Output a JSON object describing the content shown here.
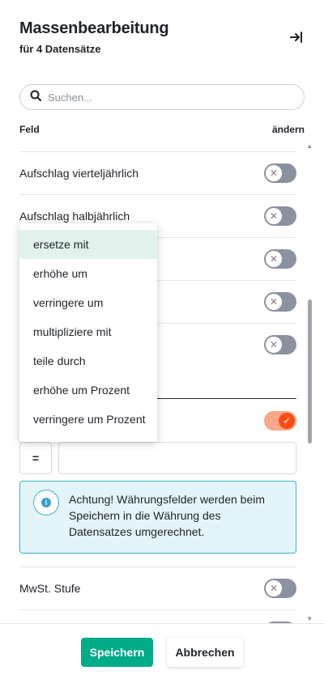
{
  "header": {
    "title": "Massenbearbeitung",
    "subtitle": "für 4 Datensätze",
    "collapse_icon": "collapse-panel-icon"
  },
  "search": {
    "placeholder": "Suchen...",
    "value": ""
  },
  "columns": {
    "field": "Feld",
    "change": "ändern"
  },
  "rows": [
    {
      "label": "Aufschlag vierteljährlich",
      "toggle": false
    },
    {
      "label": "Aufschlag halbjährlich",
      "toggle": false
    },
    {
      "label": "",
      "toggle": false
    },
    {
      "label": "",
      "toggle": false
    },
    {
      "label": "",
      "toggle": false
    },
    {
      "label": "",
      "toggle": true
    },
    {
      "label": "MwSt. Stufe",
      "toggle": false
    }
  ],
  "operator": {
    "symbol": "="
  },
  "value_input": {
    "value": ""
  },
  "alert": {
    "icon": "info-icon",
    "text": "Achtung! Währungsfelder werden beim Speichern in die Währung des Datensatzes umgerechnet."
  },
  "dropdown": {
    "selected": "ersetze mit",
    "options": [
      "ersetze mit",
      "erhöhe um",
      "verringere um",
      "multipliziere mit",
      "teile durch",
      "erhöhe um Prozent",
      "verringere um Prozent"
    ]
  },
  "footer": {
    "save_label": "Speichern",
    "cancel_label": "Abbrechen"
  },
  "colors": {
    "primary": "#00ab88",
    "toggle_on": "#ff4d12",
    "toggle_off": "#8c919f",
    "alert_border": "#3bb3c4",
    "alert_bg": "#e4f5f9",
    "selected_option_bg": "#e1f2ed"
  }
}
